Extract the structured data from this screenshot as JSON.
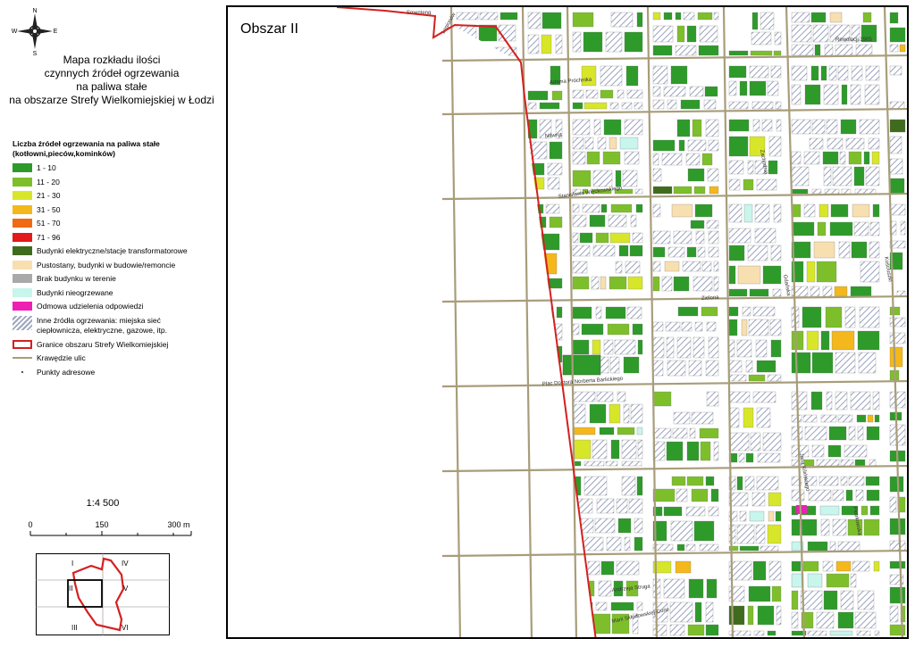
{
  "compass": {
    "n": "N",
    "s": "S",
    "e": "E",
    "w": "W"
  },
  "title_lines": [
    "Mapa rozkładu ilości",
    "czynnych źródeł ogrzewania",
    "na paliwa stałe",
    "na obszarze Strefy Wielkomiejskiej w Łodzi"
  ],
  "legend": {
    "heading_lines": [
      "Liczba źródeł ogrzewania na paliwa stałe",
      "(kotłowni,pieców,kominków)"
    ],
    "classes": [
      {
        "label": "1 - 10",
        "color": "#2e9a2a"
      },
      {
        "label": "11 - 20",
        "color": "#7dbf2b"
      },
      {
        "label": "21 - 30",
        "color": "#d8e62a"
      },
      {
        "label": "31 - 50",
        "color": "#f4b81c"
      },
      {
        "label": "51 - 70",
        "color": "#ef6a12"
      },
      {
        "label": "71 - 96",
        "color": "#e21a1a"
      }
    ],
    "other": [
      {
        "label": "Budynki elektryczne/stacje transformatorowe",
        "style": "fill",
        "color": "#3f6b1e"
      },
      {
        "label": "Pustostany, budynki w budowie/remoncie",
        "style": "fill",
        "color": "#f8dfb0"
      },
      {
        "label": "Brak budynku w terenie",
        "style": "fill",
        "color": "#a9a9a9"
      },
      {
        "label": "Budynki nieogrzewane",
        "style": "fill",
        "color": "#c8f5ec"
      },
      {
        "label": "Odmowa udzielenia odpowiedzi",
        "style": "fill",
        "color": "#ee1fb4"
      },
      {
        "label": "Inne źródła ogrzewania: miejska sieć",
        "label2": "ciepłownicza, elektryczne, gazowe, itp.",
        "style": "hatch",
        "color": "#9fa6bf"
      },
      {
        "label": "Granice obszaru Strefy Wielkomiejskiej",
        "style": "outline",
        "color": "#d42020"
      },
      {
        "label": "Krawędzie ulic",
        "style": "line",
        "color": "#a89d7a"
      },
      {
        "label": "Punkty adresowe",
        "style": "dot",
        "color": "#555555"
      }
    ]
  },
  "scale": {
    "label": "1:4 500",
    "ticks": [
      "0",
      "150",
      "300 m"
    ]
  },
  "overview": {
    "sections": [
      "I",
      "II",
      "III",
      "IV",
      "V",
      "VI"
    ],
    "current": "II"
  },
  "map": {
    "title": "Obszar II",
    "boundary_color": "#d42020",
    "street_labels": [
      "Smenteng",
      "Legionów",
      "Adama Próchnika",
      "Rewolucji 1905",
      "Nawrot",
      "Stanisława Więckowskiego",
      "Zielona",
      "Plac Doktora Norberta Barlickiego",
      "Andrzeja Struga",
      "Marii Skłodowskiej-Curie",
      "Zachodnia",
      "Gdańska",
      "Jana Kilińskiego",
      "Piotrkowska",
      "Kościuszki"
    ]
  }
}
